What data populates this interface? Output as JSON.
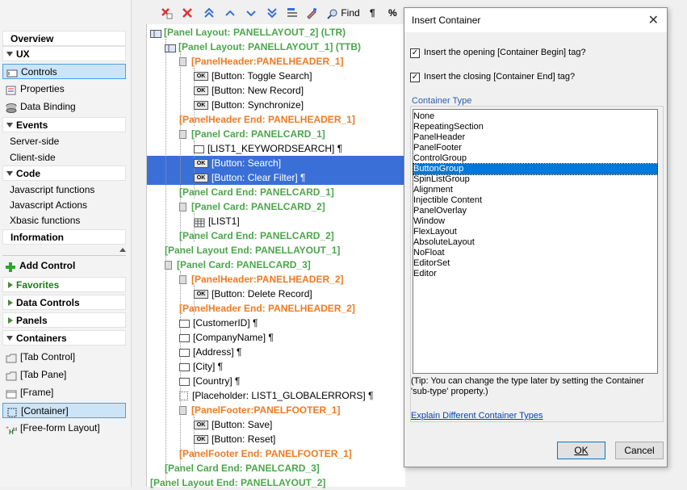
{
  "sidebar": {
    "overview": "Overview",
    "ux": "UX",
    "controls": "Controls",
    "properties": "Properties",
    "data_binding": "Data Binding",
    "events": "Events",
    "server_side": "Server-side",
    "client_side": "Client-side",
    "code": "Code",
    "js_functions": "Javascript functions",
    "js_actions": "Javascript Actions",
    "xbasic_functions": "Xbasic functions",
    "information": "Information",
    "add_control": "Add Control",
    "favorites": "Favorites",
    "data_controls": "Data Controls",
    "panels": "Panels",
    "containers": "Containers",
    "tab_control": "[Tab Control]",
    "tab_pane": "[Tab Pane]",
    "frame": "[Frame]",
    "container": "[Container]",
    "free_form": "[Free-form Layout]"
  },
  "toolbar": {
    "find": "Find",
    "pilcrow": "¶",
    "percent": "%"
  },
  "tree": [
    {
      "text": "[Panel Layout: PANELLAYOUT_2] (LTR)",
      "style": "g",
      "icon": "layout"
    },
    {
      "text": "[Panel Layout: PANELLAYOUT_1] (TTB)",
      "style": "g",
      "icon": "layout"
    },
    {
      "text": "[PanelHeader:PANELHEADER_1]",
      "style": "o",
      "icon": "sq"
    },
    {
      "text": "[Button: Toggle Search]",
      "style": "",
      "icon": "ok"
    },
    {
      "text": "[Button: New Record]",
      "style": "",
      "icon": "ok"
    },
    {
      "text": "[Button: Synchronize]",
      "style": "",
      "icon": "ok"
    },
    {
      "text": "[PanelHeader End: PANELHEADER_1]",
      "style": "o",
      "icon": ""
    },
    {
      "text": "[Panel Card: PANELCARD_1]",
      "style": "g",
      "icon": "sq"
    },
    {
      "text": "[LIST1_KEYWORDSEARCH] ¶",
      "style": "",
      "icon": "fld"
    },
    {
      "text": "[Button: Search]",
      "style": "sel",
      "icon": "ok"
    },
    {
      "text": "[Button: Clear Filter] ¶",
      "style": "sel",
      "icon": "ok"
    },
    {
      "text": "[Panel Card End: PANELCARD_1]",
      "style": "g",
      "icon": ""
    },
    {
      "text": "[Panel Card: PANELCARD_2]",
      "style": "g",
      "icon": "sq"
    },
    {
      "text": "[LIST1]",
      "style": "",
      "icon": "grid"
    },
    {
      "text": "[Panel Card End: PANELCARD_2]",
      "style": "g",
      "icon": ""
    },
    {
      "text": "[Panel Layout End: PANELLAYOUT_1]",
      "style": "g",
      "icon": ""
    },
    {
      "text": "[Panel Card: PANELCARD_3]",
      "style": "g",
      "icon": "sq"
    },
    {
      "text": "[PanelHeader:PANELHEADER_2]",
      "style": "o",
      "icon": "sq"
    },
    {
      "text": "[Button: Delete Record]",
      "style": "",
      "icon": "ok"
    },
    {
      "text": "[PanelHeader End: PANELHEADER_2]",
      "style": "o",
      "icon": ""
    },
    {
      "text": "[CustomerID] ¶",
      "style": "",
      "icon": "fld"
    },
    {
      "text": "[CompanyName] ¶",
      "style": "",
      "icon": "fld"
    },
    {
      "text": "[Address] ¶",
      "style": "",
      "icon": "fld"
    },
    {
      "text": "[City] ¶",
      "style": "",
      "icon": "fld"
    },
    {
      "text": "[Country] ¶",
      "style": "",
      "icon": "fld"
    },
    {
      "text": "[Placeholder: LIST1_GLOBALERRORS] ¶",
      "style": "",
      "icon": "dash"
    },
    {
      "text": "[PanelFooter:PANELFOOTER_1]",
      "style": "o",
      "icon": "sq"
    },
    {
      "text": "[Button: Save]",
      "style": "",
      "icon": "ok"
    },
    {
      "text": "[Button: Reset]",
      "style": "",
      "icon": "ok"
    },
    {
      "text": "[PanelFooter End: PANELFOOTER_1]",
      "style": "o",
      "icon": ""
    },
    {
      "text": "[Panel Card End: PANELCARD_3]",
      "style": "g",
      "icon": ""
    },
    {
      "text": "[Panel Layout End: PANELLAYOUT_2]",
      "style": "g",
      "icon": ""
    }
  ],
  "dialog": {
    "title": "Insert Container",
    "chk_open_label": "Insert the opening [Container Begin] tag?",
    "chk_close_label": "Insert the closing [Container End] tag?",
    "chk_open_checked": true,
    "chk_close_checked": true,
    "group_label": "Container Type",
    "types": [
      "None",
      "RepeatingSection",
      "PanelHeader",
      "PanelFooter",
      "ControlGroup",
      "ButtonGroup",
      "SpinListGroup",
      "Alignment",
      "Injectible Content",
      "PanelOverlay",
      "Window",
      "FlexLayout",
      "AbsoluteLayout",
      "NoFloat",
      "EditorSet",
      "Editor"
    ],
    "selected_type": "ButtonGroup",
    "tip": "(Tip: You can change the type later  by setting the Container 'sub-type' property.)",
    "link": "Explain Different Container Types",
    "ok": "OK",
    "cancel": "Cancel"
  }
}
